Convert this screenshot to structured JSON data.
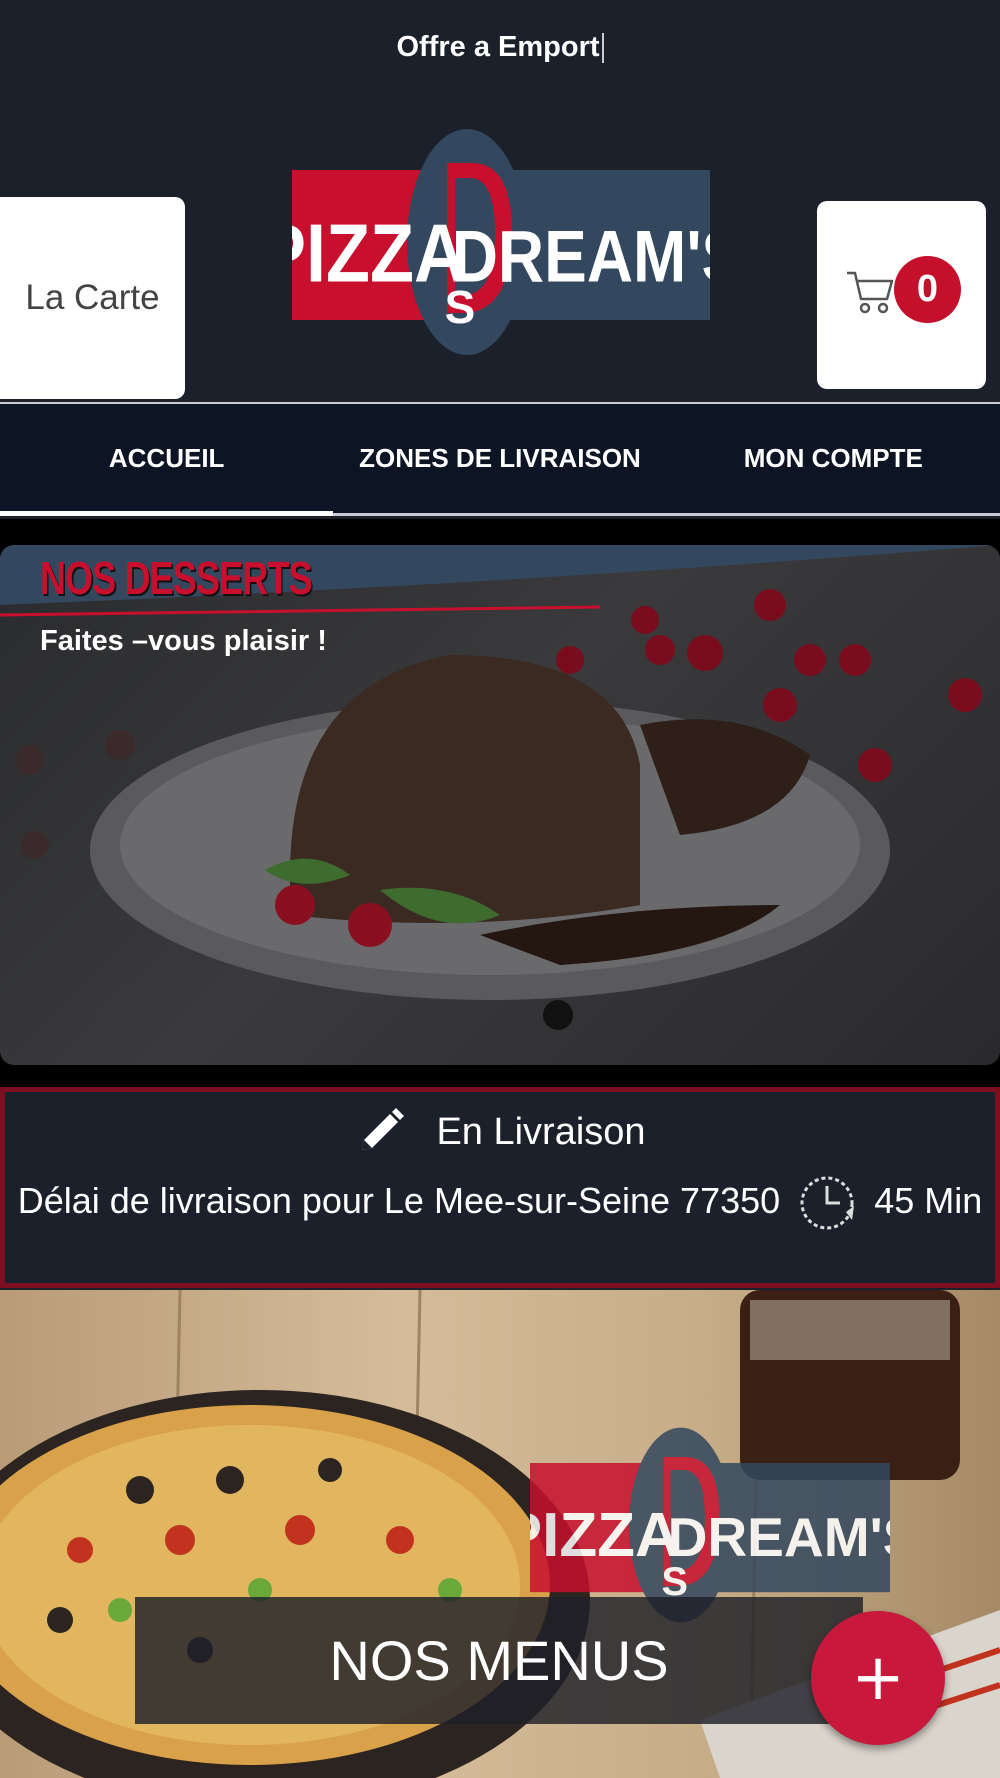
{
  "topbar": {
    "text": "Offre a Emport"
  },
  "header": {
    "carte_label": "La Carte",
    "logo": {
      "left_text": "PIZZA",
      "right_text": "DREAM'S",
      "monogram": "DS"
    },
    "cart": {
      "count": "0",
      "icon": "cart-icon"
    }
  },
  "nav": {
    "tabs": [
      {
        "label": "ACCUEIL",
        "active": true
      },
      {
        "label": "ZONES DE LIVRAISON",
        "active": false
      },
      {
        "label": "MON COMPTE",
        "active": false
      }
    ]
  },
  "banner": {
    "title": "NOS DESSERTS",
    "subtitle": "Faites –vous plaisir !"
  },
  "delivery": {
    "mode": "En Livraison",
    "text": "Délai de livraison pour Le Mee-sur-Seine 77350",
    "time": "45",
    "unit": "Min"
  },
  "menus": {
    "label": "NOS MENUS"
  },
  "fab": {
    "symbol": "+"
  },
  "colors": {
    "brand_red": "#c8102e",
    "navy": "#33475e",
    "dark_bg": "#1b202a"
  }
}
